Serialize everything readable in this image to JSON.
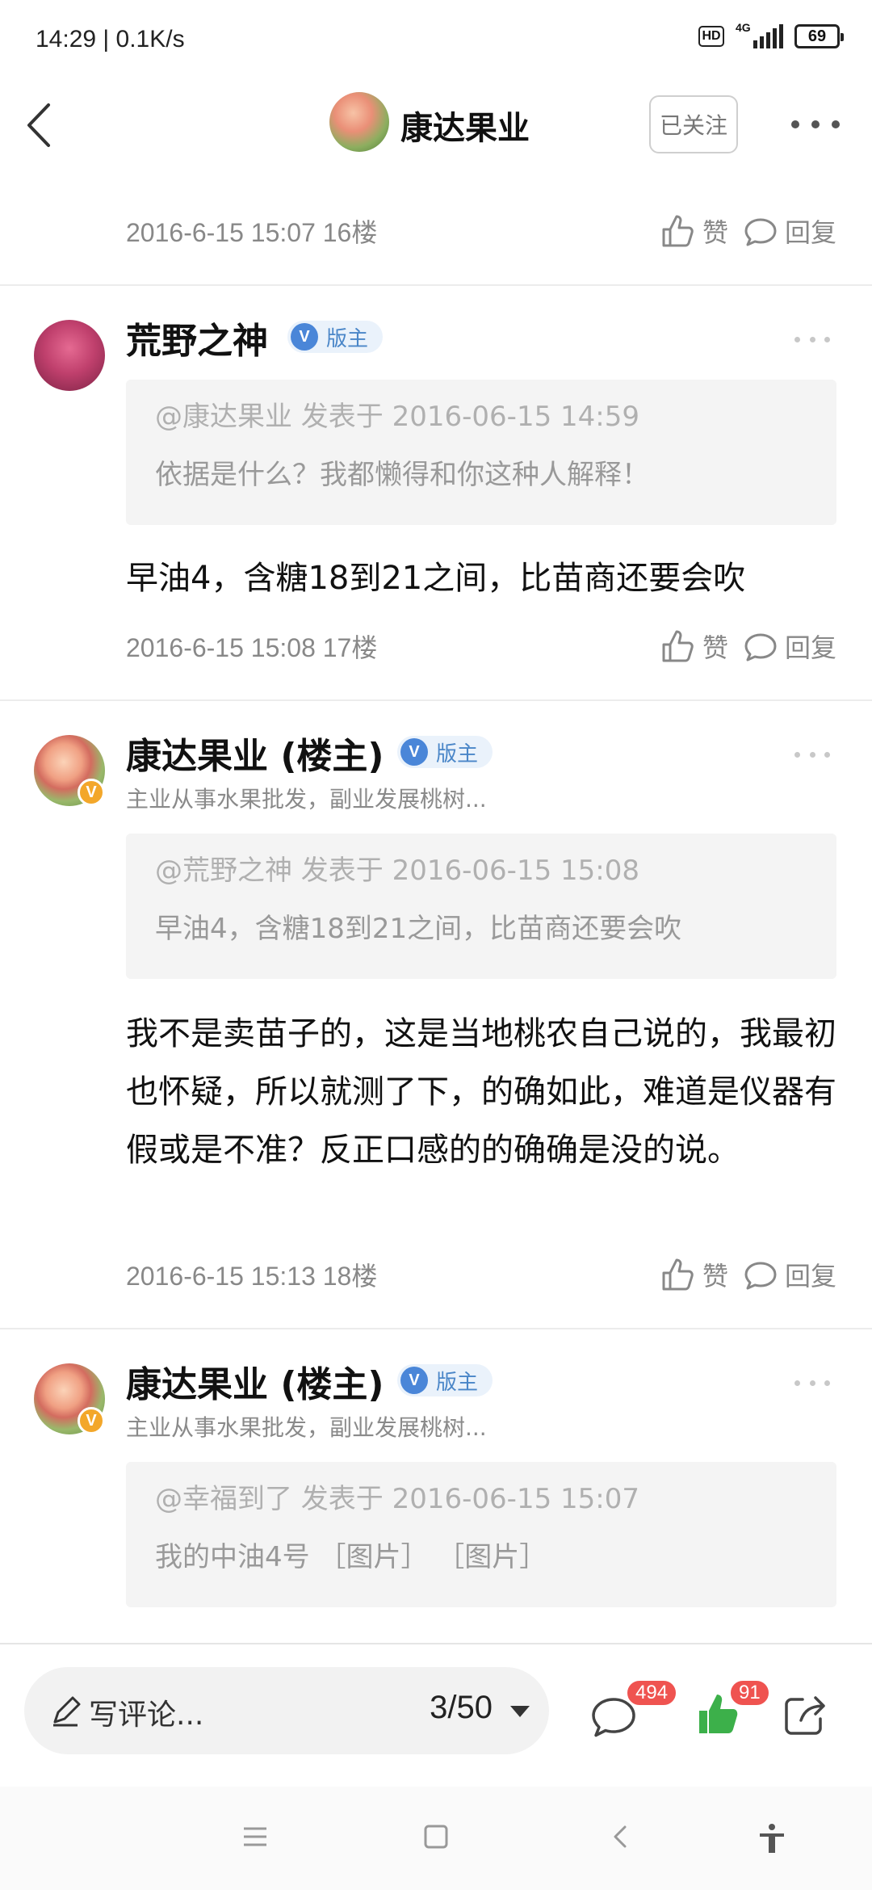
{
  "status_bar": {
    "time_speed": "14:29 | 0.1K/s",
    "hd_label": "HD",
    "network_label": "4G",
    "battery_level": "69"
  },
  "header": {
    "title": "康达果业",
    "follow_label": "已关注"
  },
  "top_meta": {
    "date_floor": "2016-6-15 15:07  16楼",
    "like_label": "赞",
    "reply_label": "回复"
  },
  "posts": [
    {
      "author": "荒野之神",
      "role_tag": "版主",
      "quote_head": "@康达果业 发表于 2016-06-15 14:59",
      "quote_body": "依据是什么？我都懒得和你这种人解释！",
      "body": "早油4，含糖18到21之间，比苗商还要会吹",
      "date_floor": "2016-6-15 15:08  17楼",
      "like_label": "赞",
      "reply_label": "回复"
    },
    {
      "author": "康达果业 (楼主)",
      "role_tag": "版主",
      "subtitle": "主业从事水果批发，副业发展桃树...",
      "quote_head": "@荒野之神 发表于 2016-06-15 15:08",
      "quote_body": "早油4，含糖18到21之间，比苗商还要会吹",
      "body": "我不是卖苗子的，这是当地桃农自己说的，我最初也怀疑，所以就测了下，的确如此，难道是仪器有假或是不准？反正口感的的确确是没的说。",
      "date_floor": "2016-6-15 15:13  18楼",
      "like_label": "赞",
      "reply_label": "回复"
    },
    {
      "author": "康达果业 (楼主)",
      "role_tag": "版主",
      "subtitle": "主业从事水果批发，副业发展桃树...",
      "quote_head": "@幸福到了 发表于 2016-06-15 15:07",
      "quote_body": "我的中油4号 ［图片］ ［图片］"
    }
  ],
  "bottom_bar": {
    "comment_placeholder": "写评论...",
    "page_indicator": "3/50",
    "comment_count": "494",
    "like_count": "91"
  },
  "icons": {
    "back": "back-arrow-icon",
    "more": "more-dots-icon",
    "like": "thumb-up-icon",
    "reply": "speech-bubble-icon",
    "share": "share-icon",
    "accessibility": "accessibility-icon"
  },
  "colors": {
    "accent_green": "#3cb04a",
    "badge_red": "#ef5350",
    "mod_blue": "#4a86d8"
  }
}
